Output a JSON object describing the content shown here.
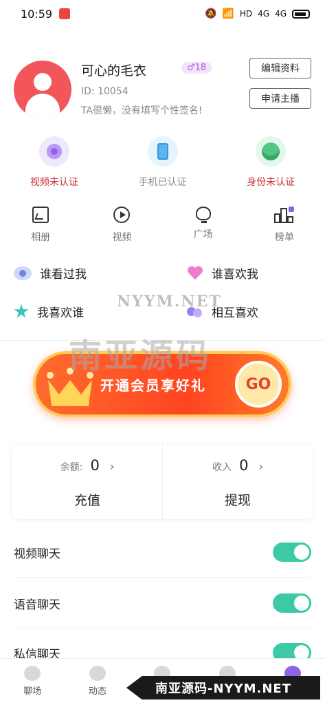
{
  "status_bar": {
    "time": "10:59",
    "network_labels": [
      "HD",
      "4G",
      "4G"
    ]
  },
  "profile": {
    "nickname": "可心的毛衣",
    "level": "18",
    "id_text": "ID: 10054",
    "signature": "TA很懒，没有填写个性签名!",
    "edit_label": "编辑资料",
    "apply_label": "申请主播"
  },
  "verification": [
    {
      "label": "视频未认证",
      "icon": "video-verify-icon",
      "color": "#c8323a"
    },
    {
      "label": "手机已认证",
      "icon": "phone-verify-icon",
      "color": "#8a8a8a"
    },
    {
      "label": "身份未认证",
      "icon": "id-verify-icon",
      "color": "#c8323a"
    }
  ],
  "menu": [
    {
      "label": "相册",
      "icon": "album-icon"
    },
    {
      "label": "视频",
      "icon": "video-icon"
    },
    {
      "label": "广场",
      "icon": "square-icon"
    },
    {
      "label": "榜单",
      "icon": "rank-icon"
    }
  ],
  "social": [
    {
      "label": "谁看过我",
      "icon": "eye-icon"
    },
    {
      "label": "谁喜欢我",
      "icon": "heart-icon"
    },
    {
      "label": "我喜欢谁",
      "icon": "star-icon"
    },
    {
      "label": "相互喜欢",
      "icon": "mutual-icon"
    }
  ],
  "watermark": {
    "url": "NYYM.NET",
    "title": "南亚源码"
  },
  "vip_banner": {
    "text": "开通会员享好礼",
    "go_label": "GO"
  },
  "wallet": {
    "balance_label": "余额:",
    "balance_value": "0",
    "recharge_label": "充值",
    "income_label": "收入",
    "income_value": "0",
    "withdraw_label": "提现"
  },
  "chat_settings": [
    {
      "label": "视频聊天",
      "enabled": true
    },
    {
      "label": "语音聊天",
      "enabled": true
    },
    {
      "label": "私信聊天",
      "enabled": true
    }
  ],
  "tabbar": [
    {
      "label": "聊场"
    },
    {
      "label": "动态"
    },
    {
      "label": ""
    },
    {
      "label": ""
    },
    {
      "label": ""
    }
  ],
  "bottom_watermark": "南亚源码-NYYM.NET",
  "colors": {
    "accent_red": "#c8323a",
    "toggle_green": "#3cc9a5",
    "vip_orange": "#ff4420",
    "level_purple": "#b05bd8"
  }
}
